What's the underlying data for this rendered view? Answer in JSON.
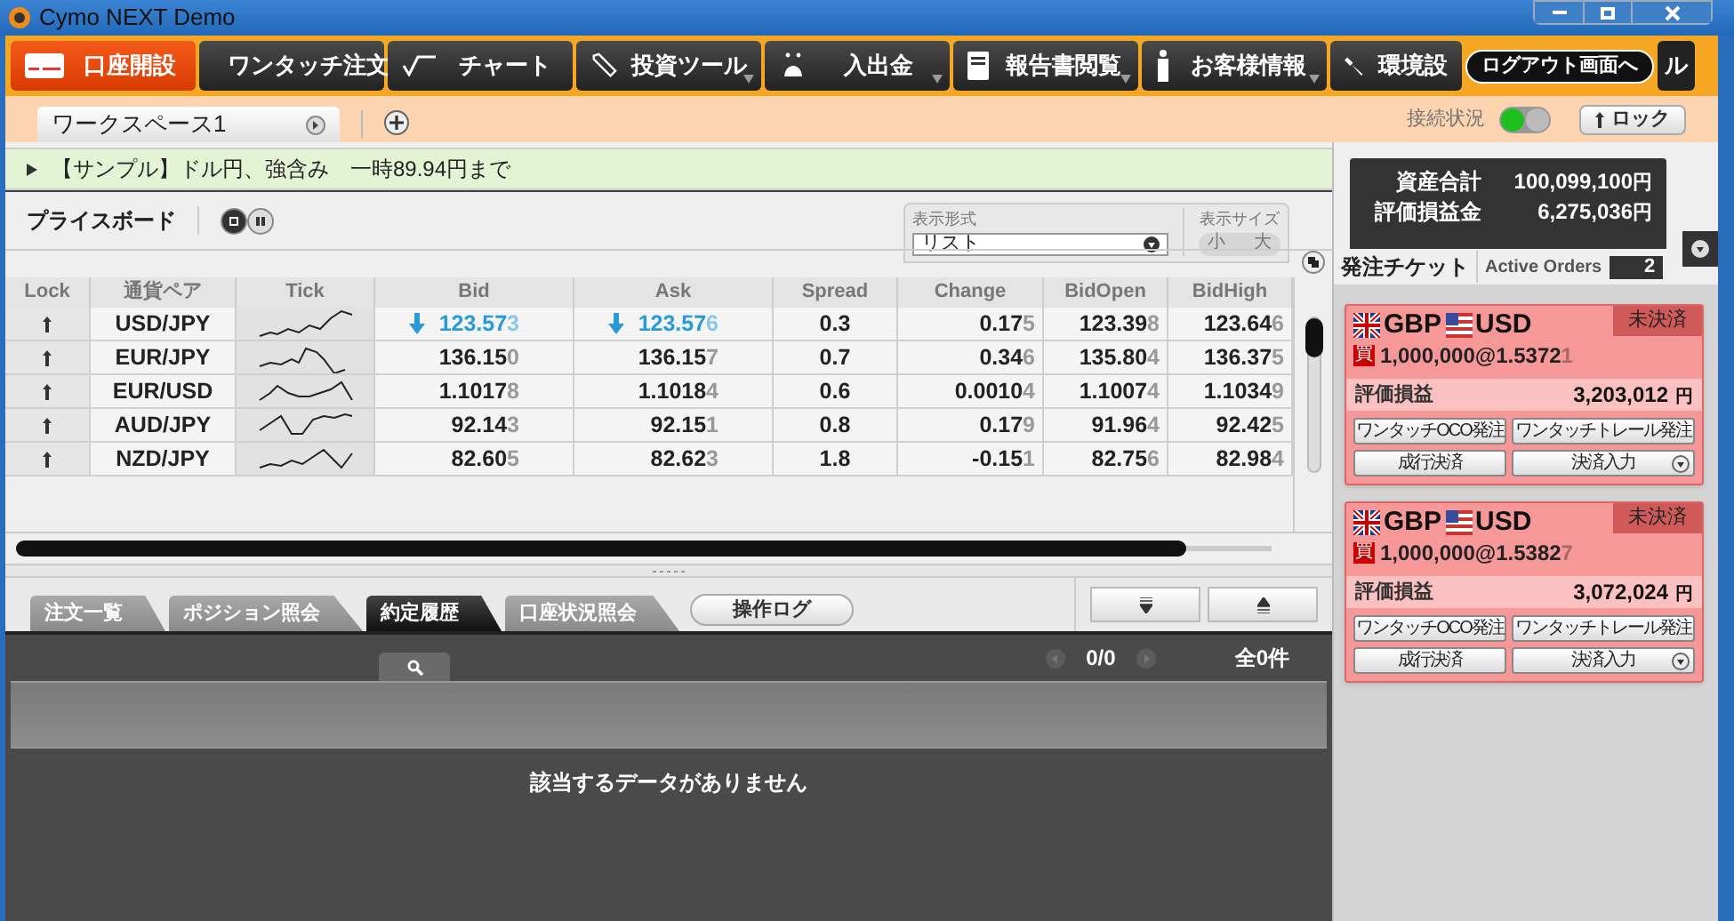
{
  "window": {
    "title": "Cymo NEXT Demo"
  },
  "menu": [
    {
      "label": "口座開設",
      "selected": true,
      "dropdown": false
    },
    {
      "label": "ワンタッチ注文",
      "selected": false,
      "dropdown": false
    },
    {
      "label": "チャート",
      "selected": false,
      "dropdown": false
    },
    {
      "label": "投資ツール",
      "selected": false,
      "dropdown": true
    },
    {
      "label": "入出金",
      "selected": false,
      "dropdown": true
    },
    {
      "label": "報告書閲覧",
      "selected": false,
      "dropdown": true
    },
    {
      "label": "お客様情報",
      "selected": false,
      "dropdown": true
    },
    {
      "label": "環境設",
      "selected": false,
      "dropdown": false
    }
  ],
  "logout_button": "ログアウト画面へ",
  "menu_tail": "ル",
  "workspace_tab": "ワークスペース1",
  "connection_label": "接続状況",
  "connected": true,
  "lock_button": "ロック",
  "news": "【サンプル】ドル円、強含み　一時89.94円まで",
  "price_board": {
    "title": "プライスボード",
    "view_mode_label": "表示形式",
    "view_mode": "リスト",
    "size_label": "表示サイズ",
    "size_small": "小",
    "size_large": "大",
    "columns": [
      "Lock",
      "通貨ペア",
      "Tick",
      "Bid",
      "Ask",
      "Spread",
      "Change",
      "BidOpen",
      "BidHigh"
    ],
    "rows": [
      {
        "pair": "USD/JPY",
        "falling": true,
        "bid": "123.573",
        "ask": "123.576",
        "spread": "0.3",
        "change": "0.175",
        "bid_open": "123.398",
        "bid_high": "123.646"
      },
      {
        "pair": "EUR/JPY",
        "falling": false,
        "bid": "136.150",
        "ask": "136.157",
        "spread": "0.7",
        "change": "0.346",
        "bid_open": "135.804",
        "bid_high": "136.375"
      },
      {
        "pair": "EUR/USD",
        "falling": false,
        "bid": "1.10178",
        "ask": "1.10184",
        "spread": "0.6",
        "change": "0.00104",
        "bid_open": "1.10074",
        "bid_high": "1.10349"
      },
      {
        "pair": "AUD/JPY",
        "falling": false,
        "bid": "92.143",
        "ask": "92.151",
        "spread": "0.8",
        "change": "0.179",
        "bid_open": "91.964",
        "bid_high": "92.425"
      },
      {
        "pair": "NZD/JPY",
        "falling": false,
        "bid": "82.605",
        "ask": "82.623",
        "spread": "1.8",
        "change": "-0.151",
        "bid_open": "82.756",
        "bid_high": "82.984"
      }
    ]
  },
  "bottom_tabs": [
    {
      "label": "注文一覧",
      "selected": false
    },
    {
      "label": "ポジション照会",
      "selected": false
    },
    {
      "label": "約定履歴",
      "selected": true
    },
    {
      "label": "口座状況照会",
      "selected": false
    }
  ],
  "log_button": "操作ログ",
  "pager": "0/0",
  "total": "全0件",
  "empty_message": "該当するデータがありません",
  "summary": [
    {
      "label": "資産合計",
      "value": "100,099,100",
      "unit": "円"
    },
    {
      "label": "評価損益金",
      "value": "6,275,036",
      "unit": "円"
    }
  ],
  "ticket_tabs": [
    {
      "label": "発注チケット",
      "selected": true
    },
    {
      "label": "Active Orders",
      "selected": false
    }
  ],
  "active_orders_count": "2",
  "positions": [
    {
      "base": "GBP",
      "quote": "USD",
      "status": "未決済",
      "side": "買",
      "amount": "1,000,000@1.53721",
      "pl_label": "評価損益",
      "pl": "3,203,012",
      "unit": "円",
      "buttons": [
        "ワンタッチOCO発注",
        "ワンタッチトレール発注",
        "成行決済",
        "決済入力"
      ]
    },
    {
      "base": "GBP",
      "quote": "USD",
      "status": "未決済",
      "side": "買",
      "amount": "1,000,000@1.53827",
      "pl_label": "評価損益",
      "pl": "3,072,024",
      "unit": "円",
      "buttons": [
        "ワンタッチOCO発注",
        "ワンタッチトレール発注",
        "成行決済",
        "決済入力"
      ]
    }
  ]
}
